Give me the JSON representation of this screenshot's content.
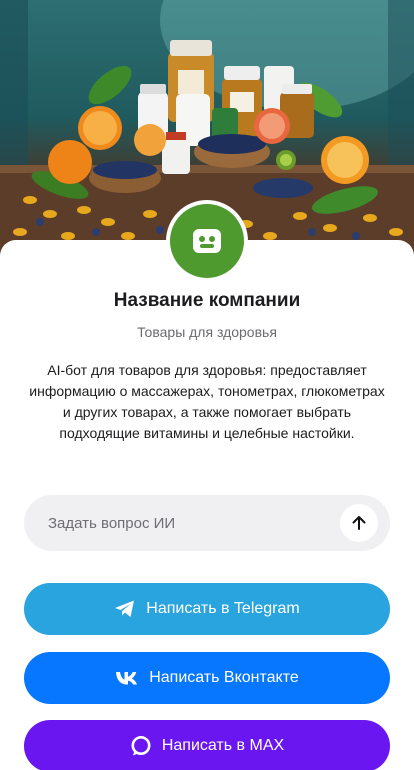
{
  "company": {
    "name": "Название компании",
    "subtitle": "Товары для здоровья",
    "description": "AI-бот для товаров для здоровья: предоставляет информацию о массажерах, тонометрах, глюкометрах и других товарах, а также помогает выбрать подходящие витамины и целебные настойки."
  },
  "ask": {
    "placeholder": "Задать вопрос ИИ",
    "send_icon": "arrow-up-icon"
  },
  "buttons": {
    "telegram": {
      "label": "Написать в Telegram",
      "icon": "telegram-icon",
      "color": "#2aa4de"
    },
    "vk": {
      "label": "Написать Вконтакте",
      "icon": "vk-icon",
      "color": "#0777ff"
    },
    "max": {
      "label": "Написать в MAX",
      "icon": "max-icon",
      "color": "#6a16f0"
    }
  },
  "colors": {
    "logo_background": "#4f9a2f",
    "ask_field_background": "#f0f0f2"
  }
}
